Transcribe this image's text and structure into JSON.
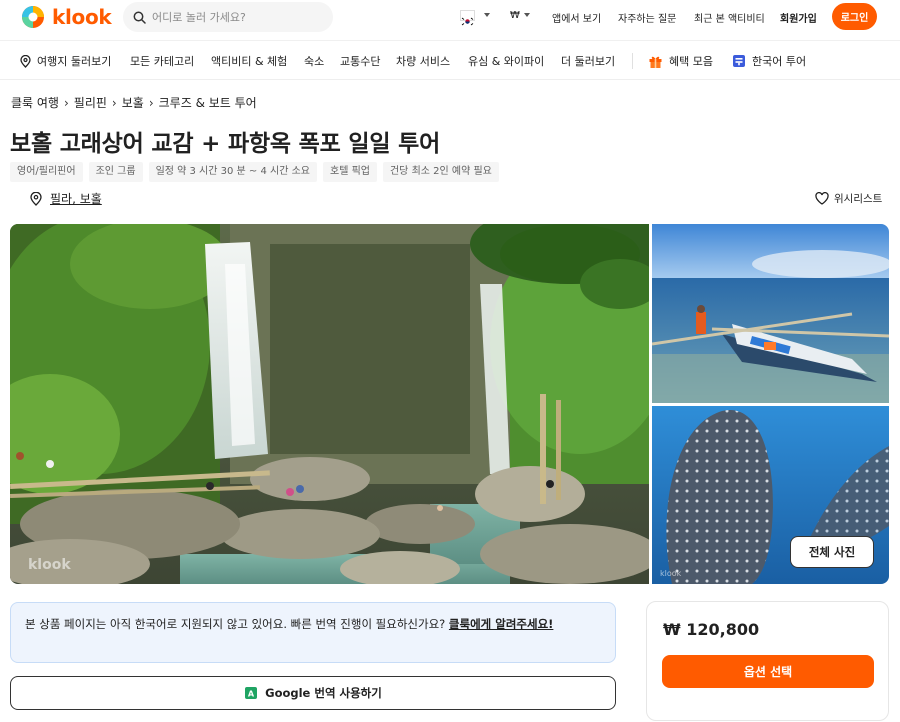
{
  "header": {
    "logo_text": "klook",
    "search_placeholder": "어디로 놀러 가세요?",
    "currency": "₩",
    "app_link": "앱에서 보기",
    "faq_link": "자주하는 질문",
    "recent_link": "최근 본 액티비티",
    "signup": "회원가입",
    "login": "로그인",
    "accent_color": "#ff5b00"
  },
  "nav": {
    "items": [
      "여행지 둘러보기",
      "모든 카테고리",
      "액티비티 & 체험",
      "숙소",
      "교통수단",
      "차량 서비스",
      "유심 & 와이파이",
      "더 둘러보기"
    ],
    "deals": "혜택 모음",
    "korean_tour": "한국어 투어"
  },
  "breadcrumb": [
    "클룩 여행",
    "필리핀",
    "보홀",
    "크루즈 & 보트 투어"
  ],
  "title": "보홀 고래상어 교감 + 파항옥 폭포 일일 투어",
  "tags": [
    "영어/필리핀어",
    "조인 그룹",
    "일정 약 3 시간 30 분 ~ 4 시간 소요",
    "호텔 픽업",
    "건당 최소 2인 예약 필요"
  ],
  "location": "필라, 보홀",
  "wishlist": "위시리스트",
  "gallery": {
    "watermark": "klook",
    "all_photos_label": "전체 사진"
  },
  "notice": {
    "text": "본 상품 페이지는 아직 한국어로 지원되지 않고 있어요. 빠른 번역 진행이 필요하신가요? ",
    "link": "클룩에게 알려주세요!"
  },
  "google_translate": "Google 번역 사용하기",
  "price": {
    "amount": "₩ 120,800",
    "button": "옵션 선택"
  }
}
